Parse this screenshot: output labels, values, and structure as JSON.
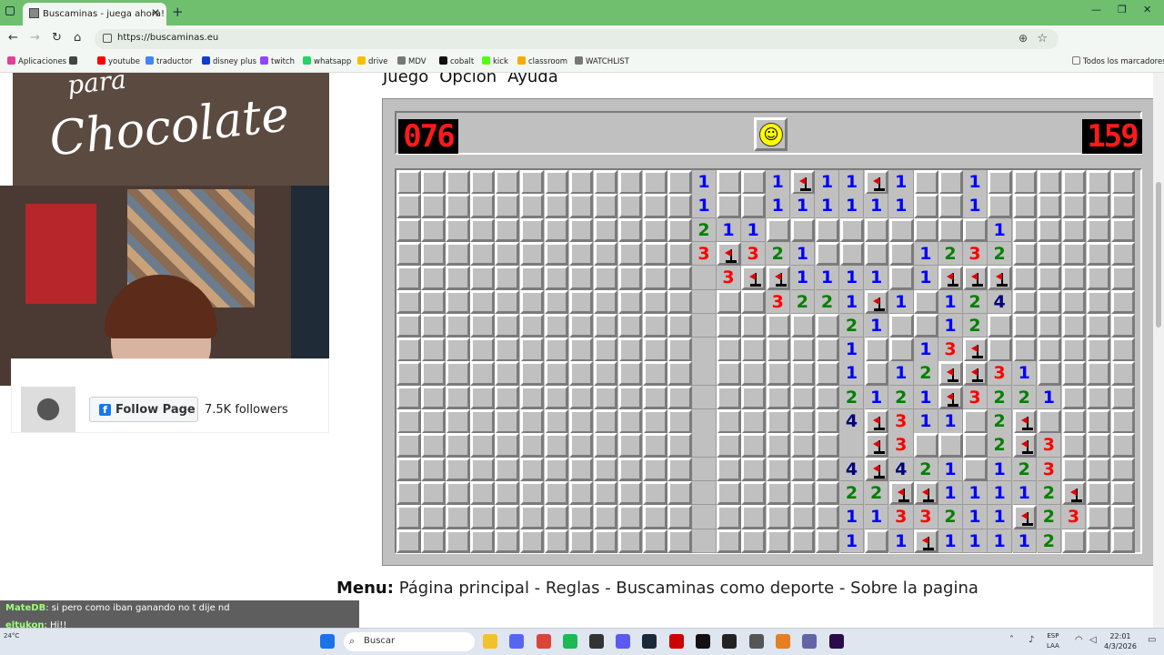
{
  "browser": {
    "tab_title": "Buscaminas - juega ahora!",
    "new_tab": "+",
    "url": "https://buscaminas.eu",
    "bookmarks": [
      {
        "label": "Aplicaciones",
        "color": "#e0409a"
      },
      {
        "label": "",
        "color": "#444444"
      },
      {
        "label": "youtube",
        "color": "#ff0000"
      },
      {
        "label": "traductor",
        "color": "#4285f4"
      },
      {
        "label": "disney plus",
        "color": "#113ccf"
      },
      {
        "label": "twitch",
        "color": "#9146ff"
      },
      {
        "label": "whatsapp",
        "color": "#25d366"
      },
      {
        "label": "drive",
        "color": "#fbbc04"
      },
      {
        "label": "MDV",
        "color": "#777777"
      },
      {
        "label": "cobalt",
        "color": "#111111"
      },
      {
        "label": "kick",
        "color": "#53fc18"
      },
      {
        "label": "classroom",
        "color": "#f9ab00"
      },
      {
        "label": "WATCHLIST",
        "color": "#777777"
      }
    ],
    "all_bookmarks": "Todos los marcadores"
  },
  "overlay": {
    "art_top": "para",
    "art_text": "Chocolate",
    "follow_button": "Follow Page",
    "followers": "7.5K followers",
    "chat": [
      {
        "user": "MateDB",
        "msg": ": si pero como iban ganando no t dije nd"
      },
      {
        "user": "eltukon",
        "msg": ": Hi!!"
      },
      {
        "user": "MateDB",
        "msg": ": todo bien rey"
      }
    ]
  },
  "game": {
    "menu": [
      "Juego",
      "Opción",
      "Ayuda"
    ],
    "mines_counter": "076",
    "timer": "159",
    "face": "☺",
    "rows": [
      "............1..1F11F1..1......",
      "............1..111111..1......",
      "............211.........1.....",
      "............3F321....1232.....",
      "............ 3FF1111.1FFF.....",
      "............ ..3221F1.124.....",
      "............ .....21..12.....",
      "............ .....1..13F.....",
      "............ .....1.12FF31....",
      "............ .....2121F3221...",
      "............ .....4F311.2F....",
      "............ ..... F3...2F3...",
      "............ .....4F421.123...",
      "............ .....22FF11112F..",
      "............ .....1133211F23..",
      "............ .....1.1F11112..."
    ],
    "page_menu_label": "Menu:",
    "page_menu_links": "Página principal - Reglas - Buscaminas como deporte - Sobre la pagina",
    "colors": {
      "1": "#0000ff",
      "2": "#008000",
      "3": "#ff0000",
      "4": "#000080",
      "5": "#800000"
    }
  },
  "taskbar": {
    "search_placeholder": "Buscar",
    "weather": "24°C",
    "lang_top": "ESP",
    "lang_bottom": "LAA",
    "time": "22:01",
    "date": "4/3/2026"
  }
}
